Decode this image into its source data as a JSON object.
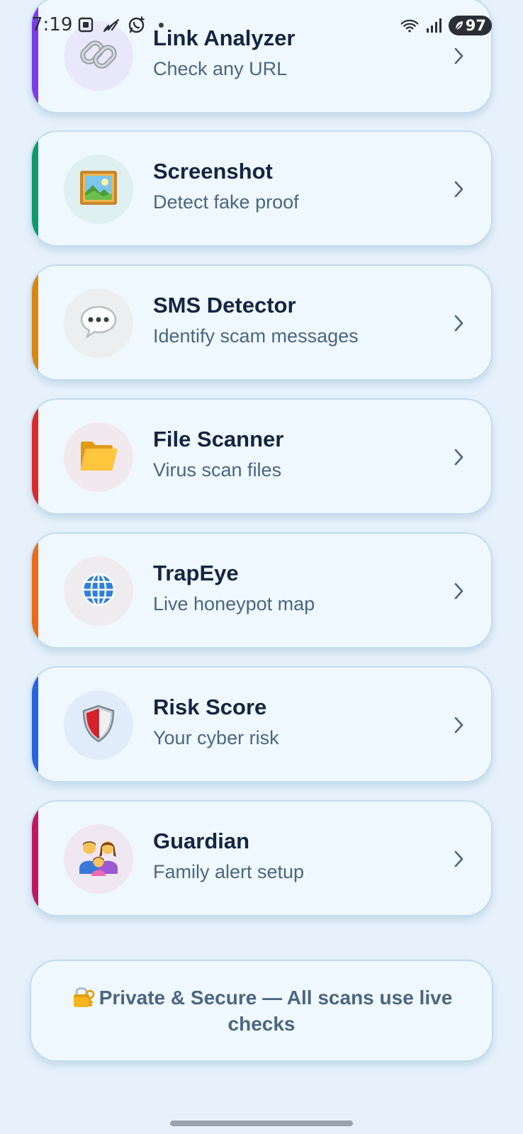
{
  "status_bar": {
    "time": "7:19",
    "battery": "97"
  },
  "cards": [
    {
      "title": "Link Analyzer",
      "subtitle": "Check any URL",
      "icon": "link-icon",
      "accent": "#7c3aed",
      "icon_bg": "#e9e8fb"
    },
    {
      "title": "Screenshot",
      "subtitle": "Detect fake proof",
      "icon": "framed-picture-icon",
      "accent": "#0e9a68",
      "icon_bg": "#e0f0f0"
    },
    {
      "title": "SMS Detector",
      "subtitle": "Identify scam messages",
      "icon": "speech-bubble-icon",
      "accent": "#d9860f",
      "icon_bg": "#ecefef"
    },
    {
      "title": "File Scanner",
      "subtitle": "Virus scan files",
      "icon": "folder-icon",
      "accent": "#dc2a2a",
      "icon_bg": "#f1e9ee"
    },
    {
      "title": "TrapEye",
      "subtitle": "Live honeypot map",
      "icon": "globe-icon",
      "accent": "#ec6a1a",
      "icon_bg": "#eeecee"
    },
    {
      "title": "Risk Score",
      "subtitle": "Your cyber risk",
      "icon": "shield-icon",
      "accent": "#2a62e0",
      "icon_bg": "#e1ecfb"
    },
    {
      "title": "Guardian",
      "subtitle": "Family alert setup",
      "icon": "family-icon",
      "accent": "#c0185e",
      "icon_bg": "#efe8f3"
    }
  ],
  "footer": {
    "text": "Private & Secure — All scans use live checks",
    "icon": "lock-with-key-icon"
  },
  "colors": {
    "background": "#e6f1fb",
    "card": "#eff8fe",
    "title": "#152440",
    "subtitle": "#4c6680"
  }
}
